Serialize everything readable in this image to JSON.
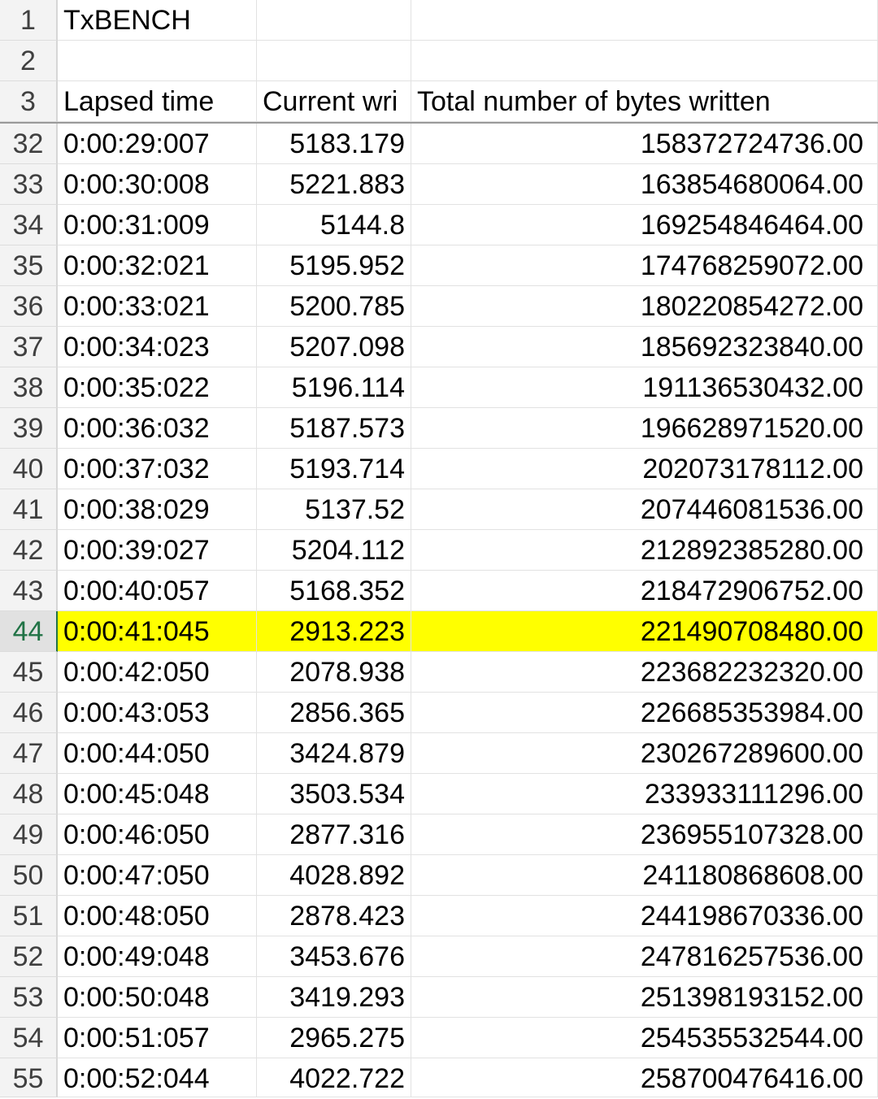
{
  "header_rows": [
    {
      "num": "1",
      "a": "TxBENCH",
      "b": "",
      "c": ""
    },
    {
      "num": "2",
      "a": "",
      "b": "",
      "c": ""
    },
    {
      "num": "3",
      "a": "Lapsed time",
      "b": "Current wri",
      "c": "Total number of bytes written"
    }
  ],
  "rows": [
    {
      "num": "32",
      "a": "0:00:29:007",
      "b": "5183.179",
      "c": "158372724736.00"
    },
    {
      "num": "33",
      "a": "0:00:30:008",
      "b": "5221.883",
      "c": "163854680064.00"
    },
    {
      "num": "34",
      "a": "0:00:31:009",
      "b": "5144.8",
      "c": "169254846464.00"
    },
    {
      "num": "35",
      "a": "0:00:32:021",
      "b": "5195.952",
      "c": "174768259072.00"
    },
    {
      "num": "36",
      "a": "0:00:33:021",
      "b": "5200.785",
      "c": "180220854272.00"
    },
    {
      "num": "37",
      "a": "0:00:34:023",
      "b": "5207.098",
      "c": "185692323840.00"
    },
    {
      "num": "38",
      "a": "0:00:35:022",
      "b": "5196.114",
      "c": "191136530432.00"
    },
    {
      "num": "39",
      "a": "0:00:36:032",
      "b": "5187.573",
      "c": "196628971520.00"
    },
    {
      "num": "40",
      "a": "0:00:37:032",
      "b": "5193.714",
      "c": "202073178112.00"
    },
    {
      "num": "41",
      "a": "0:00:38:029",
      "b": "5137.52",
      "c": "207446081536.00"
    },
    {
      "num": "42",
      "a": "0:00:39:027",
      "b": "5204.112",
      "c": "212892385280.00"
    },
    {
      "num": "43",
      "a": "0:00:40:057",
      "b": "5168.352",
      "c": "218472906752.00"
    },
    {
      "num": "44",
      "a": "0:00:41:045",
      "b": "2913.223",
      "c": "221490708480.00",
      "highlight": true
    },
    {
      "num": "45",
      "a": "0:00:42:050",
      "b": "2078.938",
      "c": "223682232320.00"
    },
    {
      "num": "46",
      "a": "0:00:43:053",
      "b": "2856.365",
      "c": "226685353984.00"
    },
    {
      "num": "47",
      "a": "0:00:44:050",
      "b": "3424.879",
      "c": "230267289600.00"
    },
    {
      "num": "48",
      "a": "0:00:45:048",
      "b": "3503.534",
      "c": "233933111296.00"
    },
    {
      "num": "49",
      "a": "0:00:46:050",
      "b": "2877.316",
      "c": "236955107328.00"
    },
    {
      "num": "50",
      "a": "0:00:47:050",
      "b": "4028.892",
      "c": "241180868608.00"
    },
    {
      "num": "51",
      "a": "0:00:48:050",
      "b": "2878.423",
      "c": "244198670336.00"
    },
    {
      "num": "52",
      "a": "0:00:49:048",
      "b": "3453.676",
      "c": "247816257536.00"
    },
    {
      "num": "53",
      "a": "0:00:50:048",
      "b": "3419.293",
      "c": "251398193152.00"
    },
    {
      "num": "54",
      "a": "0:00:51:057",
      "b": "2965.275",
      "c": "254535532544.00"
    },
    {
      "num": "55",
      "a": "0:00:52:044",
      "b": "4022.722",
      "c": "258700476416.00"
    }
  ],
  "colors": {
    "highlight": "#ffff00",
    "active_header_text": "#217346"
  }
}
